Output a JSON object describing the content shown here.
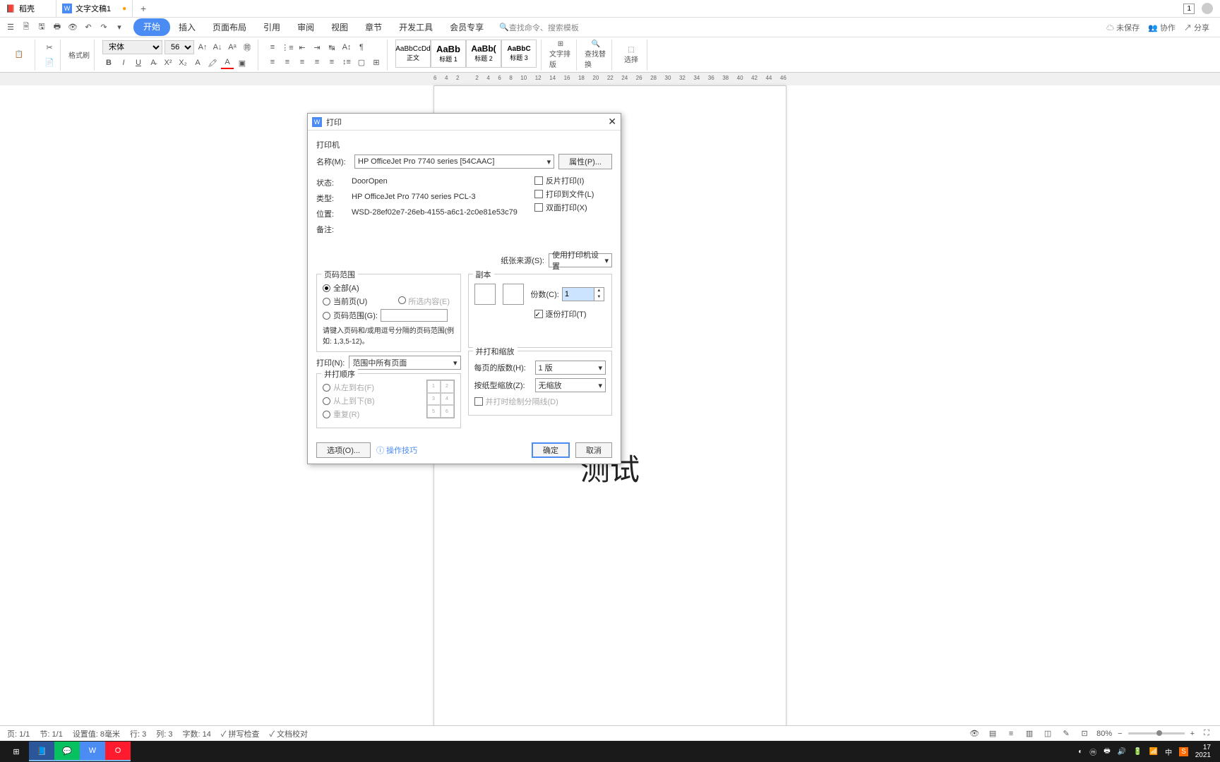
{
  "titlebar": {
    "tab1": "稻壳",
    "tab2": "文字文稿1",
    "new": "+",
    "num": "1"
  },
  "menubar": {
    "tabs": [
      "开始",
      "插入",
      "页面布局",
      "引用",
      "审阅",
      "视图",
      "章节",
      "开发工具",
      "会员专享"
    ],
    "search": "查找命令、搜索模板",
    "unsaved": "未保存",
    "coop": "协作",
    "share": "分享"
  },
  "ribbon": {
    "format_brush": "格式刷",
    "font_name": "宋体",
    "font_size": "56",
    "styles": {
      "s1_preview": "AaBbCcDd",
      "s1_name": "正文",
      "s2_preview": "AaBb",
      "s2_name": "标题 1",
      "s3_preview": "AaBb(",
      "s3_name": "标题 2",
      "s4_preview": "AaBbC",
      "s4_name": "标题 3"
    },
    "layout": "文字排版",
    "find": "查找替换",
    "select": "选择"
  },
  "ruler": [
    "6",
    "4",
    "2",
    "",
    "2",
    "4",
    "6",
    "8",
    "10",
    "12",
    "14",
    "16",
    "18",
    "20",
    "22",
    "24",
    "26",
    "28",
    "30",
    "32",
    "34",
    "36",
    "38",
    "40",
    "42",
    "44",
    "46"
  ],
  "page": {
    "text": "测试"
  },
  "dialog": {
    "title": "打印",
    "printer_section": "打印机",
    "name_label": "名称(M):",
    "name_value": "HP OfficeJet Pro 7740 series [54CAAC]",
    "props_btn": "属性(P)...",
    "status_label": "状态:",
    "status_value": "DoorOpen",
    "type_label": "类型:",
    "type_value": "HP OfficeJet Pro 7740 series PCL-3",
    "pos_label": "位置:",
    "pos_value": "WSD-28ef02e7-26eb-4155-a6c1-2c0e81e53c79",
    "remark_label": "备注:",
    "remark_value": "",
    "mirror": "反片打印(I)",
    "to_file": "打印到文件(L)",
    "duplex": "双面打印(X)",
    "paper_source_label": "纸张来源(S):",
    "paper_source_value": "使用打印机设置",
    "range_section": "页码范围",
    "range_all": "全部(A)",
    "range_current": "当前页(U)",
    "range_selection": "所选内容(E)",
    "range_pages": "页码范围(G):",
    "range_hint": "请键入页码和/或用逗号分隔的页码范围(例如: 1,3,5-12)。",
    "copies_section": "副本",
    "copies_label": "份数(C):",
    "copies_value": "1",
    "collate": "逐份打印(T)",
    "print_label": "打印(N):",
    "print_value": "范围中所有页面",
    "order_section": "并打顺序",
    "order_lr": "从左到右(F)",
    "order_tb": "从上到下(B)",
    "order_repeat": "重复(R)",
    "scale_section": "并打和缩放",
    "per_page_label": "每页的版数(H):",
    "per_page_value": "1 版",
    "scale_label": "按纸型缩放(Z):",
    "scale_value": "无缩放",
    "draw_lines": "并打时绘制分隔线(D)",
    "options_btn": "选项(O)...",
    "tips": "操作技巧",
    "ok": "确定",
    "cancel": "取消"
  },
  "statusbar": {
    "page": "页: 1/1",
    "section": "节: 1/1",
    "setval": "设置值: 8毫米",
    "row": "行: 3",
    "col": "列: 3",
    "chars": "字数: 14",
    "spell": "拼写检查",
    "proof": "文档校对",
    "zoom": "80%"
  },
  "taskbar": {
    "time": "17",
    "date": "2021"
  }
}
